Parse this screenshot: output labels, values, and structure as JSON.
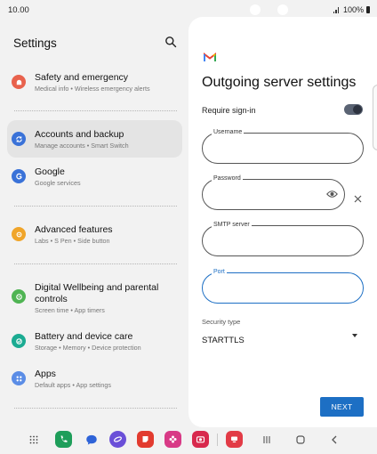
{
  "status_bar": {
    "time": "10.00",
    "battery": "100%"
  },
  "settings": {
    "title": "Settings",
    "items": [
      {
        "title": "Safety and emergency",
        "subtitle": "Medical info  •  Wireless emergency alerts",
        "icon": "safety-icon",
        "color": "#e8624d"
      },
      {
        "title": "Accounts and backup",
        "subtitle": "Manage accounts  •  Smart Switch",
        "icon": "sync-icon",
        "color": "#3a72d8"
      },
      {
        "title": "Google",
        "subtitle": "Google services",
        "icon": "google-icon",
        "color": "#3a72d8"
      },
      {
        "title": "Advanced features",
        "subtitle": "Labs  •  S Pen  •  Side button",
        "icon": "advanced-features-icon",
        "color": "#f0a52a"
      },
      {
        "title": "Digital Wellbeing and parental controls",
        "subtitle": "Screen time  •  App timers",
        "icon": "wellbeing-icon",
        "color": "#4fb453"
      },
      {
        "title": "Battery and device care",
        "subtitle": "Storage  •  Memory  •  Device protection",
        "icon": "device-care-icon",
        "color": "#1bab92"
      },
      {
        "title": "Apps",
        "subtitle": "Default apps  •  App settings",
        "icon": "apps-icon",
        "color": "#5b8de6"
      }
    ]
  },
  "gmail": {
    "title": "Outgoing server settings",
    "require_signin_label": "Require sign-in",
    "require_signin_on": true,
    "fields": [
      {
        "label": "Username",
        "value": ""
      },
      {
        "label": "Password",
        "value": ""
      },
      {
        "label": "SMTP server",
        "value": ""
      },
      {
        "label": "Port",
        "value": ""
      }
    ],
    "security_type_label": "Security type",
    "security_type_value": "STARTTLS",
    "next_label": "NEXT",
    "accent": "#1d6fc4"
  },
  "taskbar": {
    "apps": [
      "apps-grid-icon",
      "phone-icon",
      "messages-icon",
      "internet-icon",
      "s-note-icon",
      "gallery-icon",
      "camera-icon",
      "recents-app-icon"
    ],
    "nav": [
      "recents-nav-icon",
      "home-nav-icon",
      "back-nav-icon"
    ]
  }
}
